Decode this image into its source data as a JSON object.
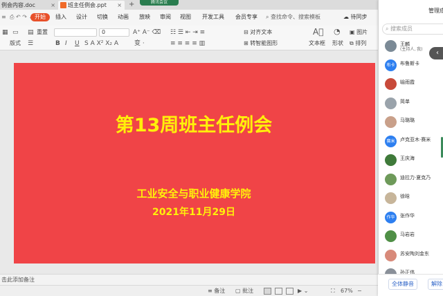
{
  "tabs": [
    {
      "label": "例会内容.doc"
    },
    {
      "label": "班主任例会.ppt"
    }
  ],
  "tabbar": {
    "new_tab": "+",
    "meeting_label": "腾讯会议"
  },
  "menu": {
    "items": [
      "开始",
      "插入",
      "设计",
      "切换",
      "动画",
      "放映",
      "审阅",
      "视图",
      "开发工具",
      "会员专享"
    ],
    "search_hint": "查找命令、搜索模板",
    "cloud": "待同步"
  },
  "toolbar": {
    "format_painter": "重置",
    "layout": "版式",
    "font_size": "0",
    "align_text": "对齐文本",
    "convert_smart": "转智能图形",
    "textbox": "文本框",
    "shape": "形状",
    "picture": "图片",
    "arrange": "排列"
  },
  "slide": {
    "title": "第13周班主任例会",
    "subtitle1": "工业安全与职业健康学院",
    "subtitle2": "2021年11月29日",
    "background": "#f04447",
    "text_color": "#fff00a"
  },
  "notes": {
    "placeholder": "击此添加备注"
  },
  "statusbar": {
    "notes_btn": "备注",
    "comment_btn": "批注",
    "zoom": "67%"
  },
  "panel": {
    "title": "管理成",
    "search_placeholder": "搜索成员",
    "members": [
      {
        "name": "王麟",
        "note": "(主持人, 我)",
        "avatar_text": "",
        "avatar_color": "#7b8a96"
      },
      {
        "name": "布鲁斯卡",
        "note": "",
        "avatar_text": "布卡",
        "avatar_color": "#2d7ff0"
      },
      {
        "name": "喻雨霞",
        "note": "",
        "avatar_text": "",
        "avatar_color": "#c84a3a"
      },
      {
        "name": "简单",
        "note": "",
        "avatar_text": "",
        "avatar_color": "#9aa3ab"
      },
      {
        "name": "马璐璐",
        "note": "",
        "avatar_text": "",
        "avatar_color": "#c9a08a"
      },
      {
        "name": "卢克亚木·赛米",
        "note": "",
        "avatar_text": "赛米",
        "avatar_color": "#2d7ff0"
      },
      {
        "name": "王庆海",
        "note": "",
        "avatar_text": "",
        "avatar_color": "#3f7a3a"
      },
      {
        "name": "迪拉力·夏克乃",
        "note": "",
        "avatar_text": "",
        "avatar_color": "#6e9a5a"
      },
      {
        "name": "徐晗",
        "note": "",
        "avatar_text": "",
        "avatar_color": "#c7b59a"
      },
      {
        "name": "张作华",
        "note": "",
        "avatar_text": "作华",
        "avatar_color": "#2d7ff0"
      },
      {
        "name": "马岩岩",
        "note": "",
        "avatar_text": "",
        "avatar_color": "#4f8f46"
      },
      {
        "name": "苏安陶刘金东",
        "note": "",
        "avatar_text": "",
        "avatar_color": "#d88a7a"
      },
      {
        "name": "孙正伟",
        "note": "",
        "avatar_text": "",
        "avatar_color": "#8a9099"
      }
    ],
    "mute_all": "全体静音",
    "unmute_all": "解除"
  }
}
